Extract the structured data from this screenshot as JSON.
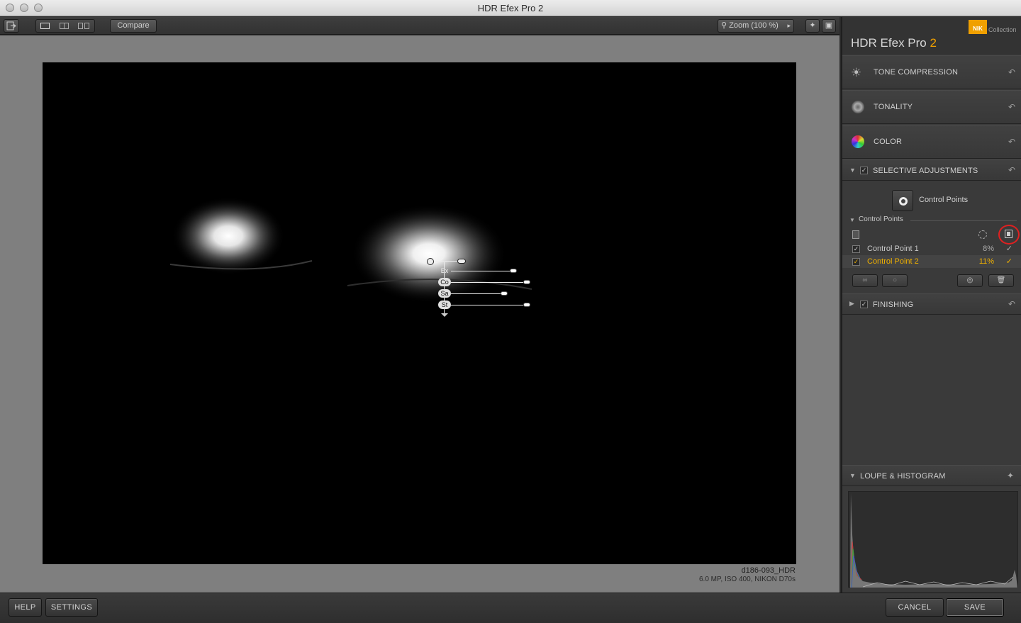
{
  "window": {
    "title": "HDR Efex Pro 2"
  },
  "toolbar": {
    "compare_label": "Compare",
    "zoom_label": "Zoom (100 %)"
  },
  "image_info": {
    "filename": "d186-093_HDR",
    "details": "6.0 MP, ISO 400, NIKON D70s"
  },
  "control_point_overlay": {
    "sliders": [
      {
        "label": "Ex",
        "value": 0.55
      },
      {
        "label": "Co",
        "value": 0.75
      },
      {
        "label": "Sa",
        "value": 0.42
      },
      {
        "label": "St",
        "value": 0.75
      }
    ]
  },
  "panel": {
    "brand_title": "HDR Efex Pro",
    "brand_version": "2",
    "brand_logo_text": "NIK",
    "brand_collection": "Collection",
    "sections": {
      "tone_compression": "TONE COMPRESSION",
      "tonality": "TONALITY",
      "color": "COLOR",
      "selective_adjustments": "SELECTIVE ADJUSTMENTS",
      "finishing": "FINISHING",
      "loupe_histogram": "LOUPE & HISTOGRAM"
    },
    "control_points_button": "Control Points",
    "control_points_header": "Control Points",
    "control_points": [
      {
        "name": "Control Point 1",
        "value": "8%",
        "checked": true,
        "selected": false
      },
      {
        "name": "Control Point 2",
        "value": "11%",
        "checked": true,
        "selected": true
      }
    ]
  },
  "bottom": {
    "help": "HELP",
    "settings": "SETTINGS",
    "cancel": "CANCEL",
    "save": "SAVE"
  },
  "colors": {
    "accent": "#f0a000",
    "selected_text": "#f0b000",
    "highlight_ring": "#e02020"
  }
}
